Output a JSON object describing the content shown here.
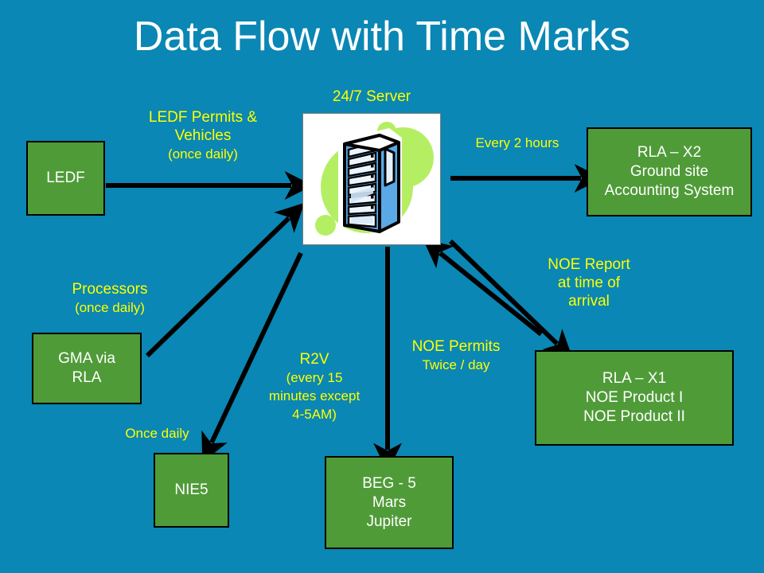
{
  "slide": {
    "title": "Data Flow with Time Marks",
    "background_color": "#0a87b4",
    "node_fill_color": "#4f9b38",
    "node_border_color": "#000000",
    "node_text_color": "#ffffff",
    "label_text_color": "#ffff00",
    "title_text_color": "#ffffff",
    "arrow_color": "#000000"
  },
  "nodes": {
    "ledf": {
      "lines": [
        "LEDF"
      ]
    },
    "rla_x2": {
      "lines": [
        "RLA – X2",
        "Ground site",
        "Accounting System"
      ]
    },
    "gma": {
      "lines": [
        "GMA via",
        "RLA"
      ]
    },
    "rla_x1": {
      "lines": [
        "RLA – X1",
        "NOE Product I",
        "NOE Product II"
      ]
    },
    "nie5": {
      "lines": [
        "NIE5"
      ]
    },
    "beg5": {
      "lines": [
        "BEG - 5",
        "Mars",
        "Jupiter"
      ]
    }
  },
  "server": {
    "caption": "24/7 Server",
    "icon": "server-tower-clipart",
    "blob_color": "#b4ef63",
    "tower_color": "#5aa9e6",
    "card_background": "#ffffff"
  },
  "labels": {
    "ledf_flow": {
      "line1": "LEDF Permits &",
      "line2": "Vehicles",
      "line3": "(once daily)"
    },
    "every_two_hours": {
      "line1": "Every 2 hours"
    },
    "noe_report": {
      "line1": "NOE Report",
      "line2": "at time of",
      "line3": "arrival"
    },
    "processors": {
      "line1": "Processors",
      "line2": "(once daily)"
    },
    "r2v": {
      "line1": "R2V",
      "line2": "(every 15",
      "line3": "minutes except",
      "line4": "4-5AM)"
    },
    "noe_permits": {
      "line1": "NOE Permits",
      "line2": "Twice / day"
    },
    "once_daily": {
      "line1": "Once daily"
    }
  }
}
